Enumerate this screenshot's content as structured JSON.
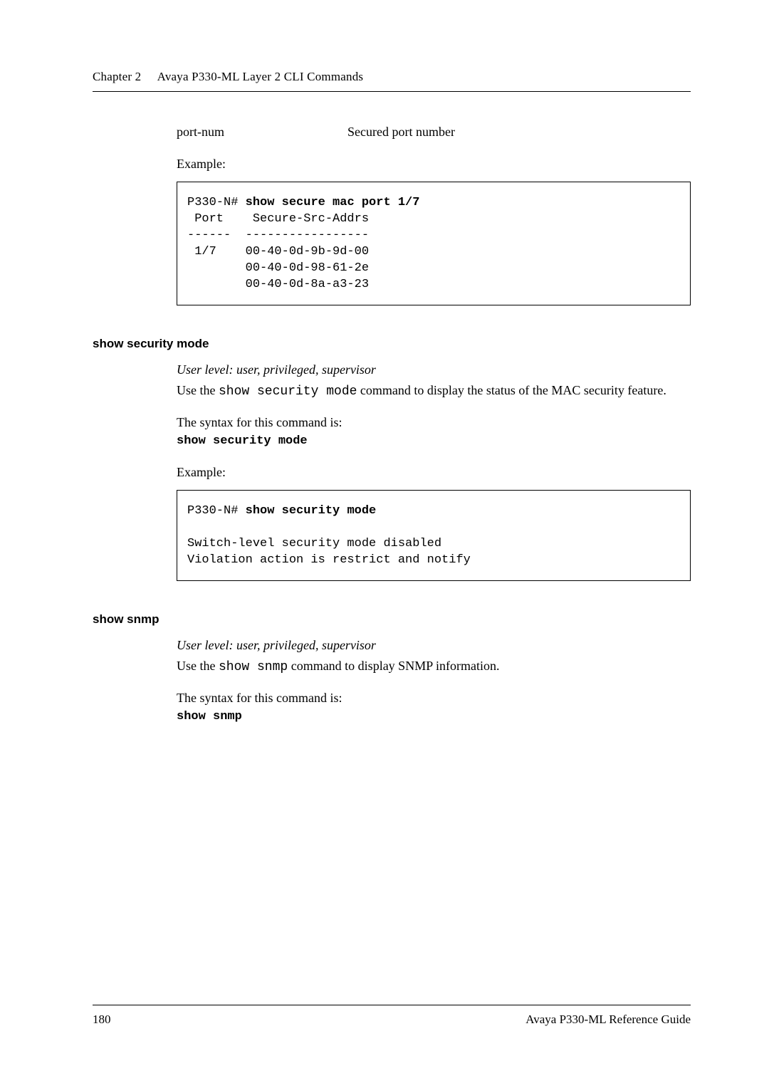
{
  "header": {
    "chapter": "Chapter 2",
    "title": "Avaya P330-ML Layer 2 CLI Commands"
  },
  "param": {
    "name": "port-num",
    "desc": "Secured port number"
  },
  "example_label": "Example:",
  "code1": {
    "line1_prefix": "P330-N# ",
    "line1_bold": "show secure mac port 1/7",
    "line2": " Port    Secure-Src-Addrs",
    "line3": "------  -----------------",
    "line4": " 1/7    00-40-0d-9b-9d-00",
    "line5": "        00-40-0d-98-61-2e",
    "line6": "        00-40-0d-8a-a3-23"
  },
  "sec1": {
    "heading": "show security mode",
    "user_level": "User level: user, privileged, supervisor",
    "desc_pre": "Use the ",
    "desc_mono": "show security mode",
    "desc_post": " command to display the status of the MAC security feature.",
    "syntax_label": "The syntax for this command is:",
    "syntax": "show security mode",
    "example_label": "Example:",
    "code": {
      "line1_prefix": "P330-N# ",
      "line1_bold": "show security mode",
      "line2": "",
      "line3": "Switch-level security mode disabled",
      "line4": "Violation action is restrict and notify"
    }
  },
  "sec2": {
    "heading": "show snmp",
    "user_level": "User level: user, privileged, supervisor",
    "desc_pre": "Use the ",
    "desc_mono": "show snmp",
    "desc_post": " command to display SNMP information.",
    "syntax_label": "The syntax for this command is:",
    "syntax": "show snmp"
  },
  "footer": {
    "page": "180",
    "doc": "Avaya P330-ML Reference Guide"
  }
}
